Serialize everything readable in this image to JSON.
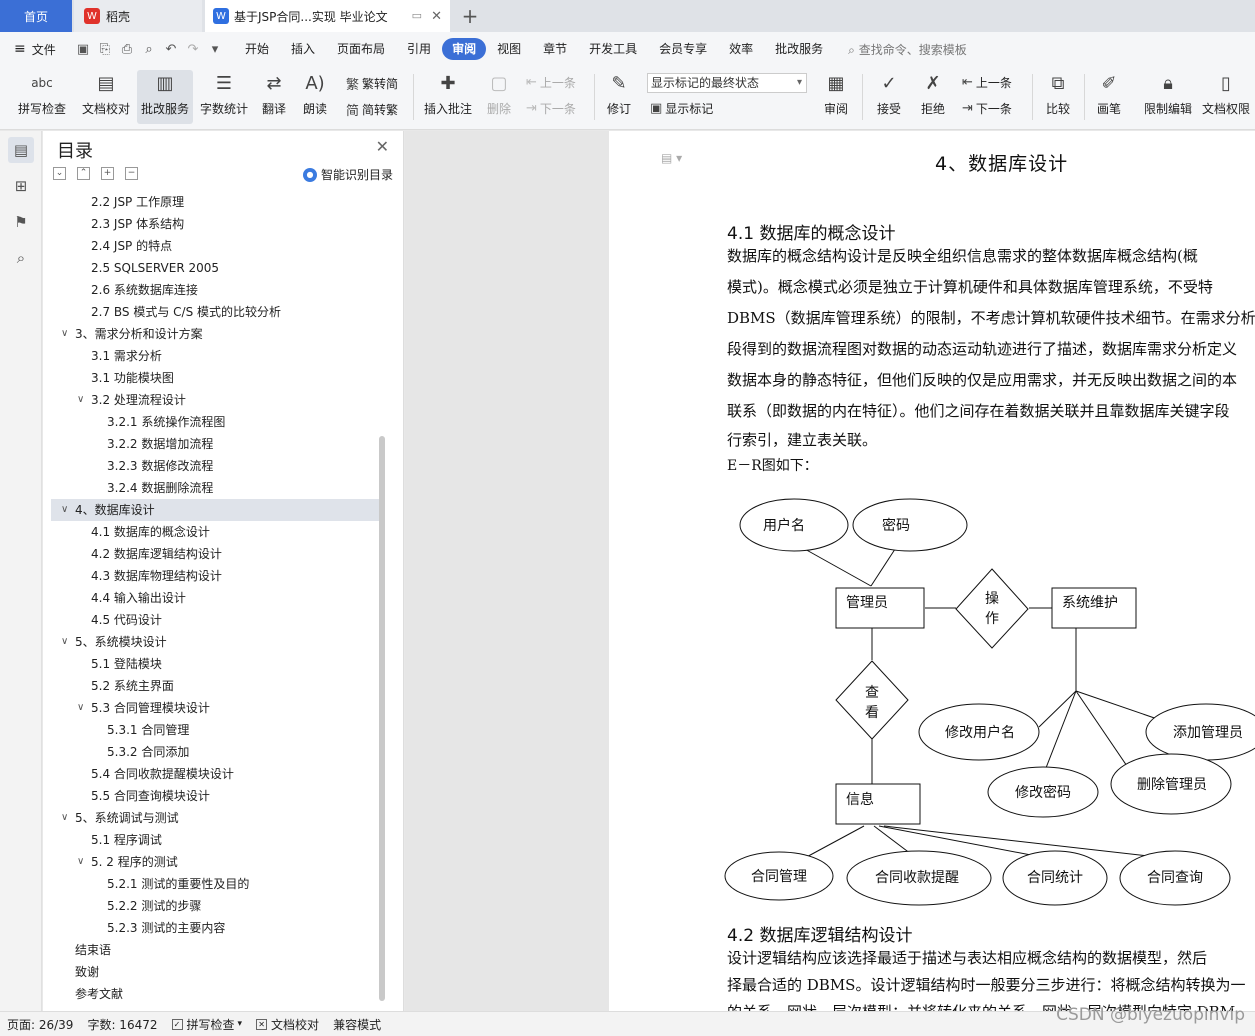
{
  "tabs": {
    "home": "首页",
    "daoke": "稻壳",
    "doc": "基于JSP合同...实现 毕业论文",
    "add": "+"
  },
  "menu": {
    "file": "文件",
    "items": [
      "开始",
      "插入",
      "页面布局",
      "引用",
      "审阅",
      "视图",
      "章节",
      "开发工具",
      "会员专享",
      "效率",
      "批改服务"
    ],
    "active_index": 4,
    "search": "查找命令、搜索模板"
  },
  "ribbon": {
    "spell": "拼写检查",
    "doccheck": "文档校对",
    "review_service": "批改服务",
    "wordcount": "字数统计",
    "translate": "翻译",
    "read": "朗读",
    "trad": "繁转简",
    "simp": "简转繁",
    "insert_comment": "插入批注",
    "delete": "删除",
    "prev": "上一条",
    "next": "下一条",
    "track": "修订",
    "markup_combo": "显示标记的最终状态",
    "show_markup": "显示标记",
    "review": "审阅",
    "accept": "接受",
    "reject": "拒绝",
    "prev2": "上一条",
    "next2": "下一条",
    "compare": "比较",
    "pen": "画笔",
    "restrict": "限制编辑",
    "perm": "文档权限"
  },
  "toc": {
    "title": "目录",
    "smart": "智能识别目录",
    "items": [
      {
        "label": "2.2 JSP 工作原理",
        "level": 2
      },
      {
        "label": "2.3 JSP 体系结构",
        "level": 2
      },
      {
        "label": "2.4 JSP 的特点",
        "level": 2
      },
      {
        "label": "2.5 SQLSERVER 2005",
        "level": 2
      },
      {
        "label": "2.6 系统数据库连接",
        "level": 2
      },
      {
        "label": "2.7 BS 模式与 C/S 模式的比较分析",
        "level": 2
      },
      {
        "label": "3、需求分析和设计方案",
        "level": 1,
        "chev": true
      },
      {
        "label": "3.1 需求分析",
        "level": 2
      },
      {
        "label": "3.1 功能模块图",
        "level": 2
      },
      {
        "label": "3.2 处理流程设计",
        "level": 2,
        "chev": true
      },
      {
        "label": "3.2.1 系统操作流程图",
        "level": 3
      },
      {
        "label": "3.2.2 数据增加流程",
        "level": 3
      },
      {
        "label": "3.2.3 数据修改流程",
        "level": 3
      },
      {
        "label": "3.2.4 数据删除流程",
        "level": 3
      },
      {
        "label": "4、数据库设计",
        "level": 1,
        "chev": true,
        "selected": true
      },
      {
        "label": "4.1 数据库的概念设计",
        "level": 2
      },
      {
        "label": "4.2 数据库逻辑结构设计",
        "level": 2
      },
      {
        "label": "4.3 数据库物理结构设计",
        "level": 2
      },
      {
        "label": "4.4 输入输出设计",
        "level": 2
      },
      {
        "label": "4.5 代码设计",
        "level": 2
      },
      {
        "label": "5、系统模块设计",
        "level": 1,
        "chev": true
      },
      {
        "label": "5.1 登陆模块",
        "level": 2
      },
      {
        "label": "5.2 系统主界面",
        "level": 2
      },
      {
        "label": "5.3 合同管理模块设计",
        "level": 2,
        "chev": true
      },
      {
        "label": "5.3.1 合同管理",
        "level": 3
      },
      {
        "label": "5.3.2 合同添加",
        "level": 3
      },
      {
        "label": "5.4 合同收款提醒模块设计",
        "level": 2
      },
      {
        "label": "5.5 合同查询模块设计",
        "level": 2
      },
      {
        "label": "5、系统调试与测试",
        "level": 1,
        "chev": true
      },
      {
        "label": "5.1 程序调试",
        "level": 2
      },
      {
        "label": "5. 2 程序的测试",
        "level": 2,
        "chev": true
      },
      {
        "label": "5.2.1 测试的重要性及目的",
        "level": 3
      },
      {
        "label": "5.2.2 测试的步骤",
        "level": 3
      },
      {
        "label": "5.2.3 测试的主要内容",
        "level": 3
      },
      {
        "label": "结束语",
        "level": 1
      },
      {
        "label": "致谢",
        "level": 1
      },
      {
        "label": "参考文献",
        "level": 1
      }
    ]
  },
  "doc": {
    "chapter": "4、数据库设计",
    "sec1": "4.1 数据库的概念设计",
    "para1": [
      "    数据库的概念结构设计是反映全组织信息需求的整体数据库概念结构(概",
      "模式)。概念模式必须是独立于计算机硬件和具体数据库管理系统，不受特",
      "DBMS（数据库管理系统）的限制，不考虑计算机软硬件技术细节。在需求分析",
      "段得到的数据流程图对数据的动态运动轨迹进行了描述，数据库需求分析定义",
      "数据本身的静态特征，但他们反映的仅是应用需求，并无反映出数据之间的本",
      "联系（即数据的内在特征）。他们之间存在着数据关联并且靠数据库关键字段",
      "行索引，建立表关联。",
      "    E－R图如下："
    ],
    "er": {
      "username": "用户名",
      "password": "密码",
      "admin": "管理员",
      "op1": "操",
      "op2": "作",
      "sysmaint": "系统维护",
      "view1": "查",
      "view2": "看",
      "edit_user": "修改用户名",
      "add_admin": "添加管理员",
      "edit_pwd": "修改密码",
      "del_admin": "删除管理员",
      "info": "信息",
      "contract_mgmt": "合同管理",
      "contract_remind": "合同收款提醒",
      "contract_stat": "合同统计",
      "contract_query": "合同查询"
    },
    "sec2": "4.2 数据库逻辑结构设计",
    "para2": [
      "    设计逻辑结构应该选择最适于描述与表达相应概念结构的数据模型，然后",
      "择最合适的 DBMS。设计逻辑结构时一般要分三步进行：将概念结构转换为一",
      "的关系、网状、层次模型；并将转化来的关系、网状、层次模型向特定 DBM"
    ]
  },
  "status": {
    "page": "页面: 26/39",
    "words": "字数: 16472",
    "spell": "拼写检查",
    "doccheck": "文档校对",
    "compat": "兼容模式"
  },
  "watermark": "CSDN @biyezuopinvip"
}
